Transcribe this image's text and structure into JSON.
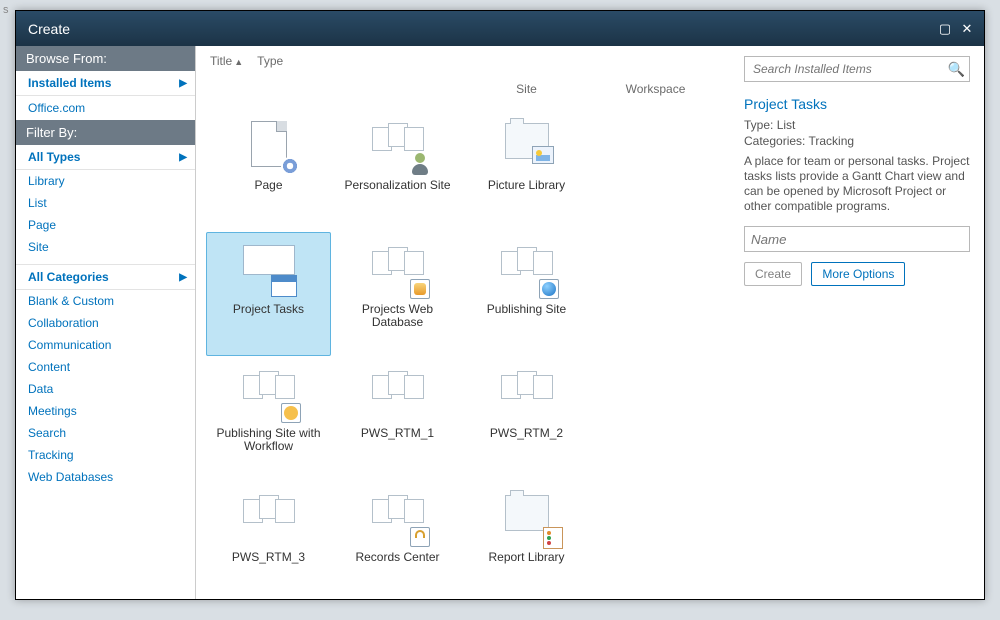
{
  "dialog_title": "Create",
  "sidebar": {
    "browse_header": "Browse From:",
    "browse_items": [
      "Installed Items",
      "Office.com"
    ],
    "filter_header": "Filter By:",
    "all_types": "All Types",
    "types": [
      "Library",
      "List",
      "Page",
      "Site"
    ],
    "all_categories": "All Categories",
    "categories": [
      "Blank & Custom",
      "Collaboration",
      "Communication",
      "Content",
      "Data",
      "Meetings",
      "Search",
      "Tracking",
      "Web Databases"
    ]
  },
  "list": {
    "sort_title": "Title",
    "sort_type": "Type",
    "type_headers": [
      "",
      "",
      "Site",
      "Workspace"
    ],
    "items": [
      {
        "label": "Page"
      },
      {
        "label": "Personalization Site"
      },
      {
        "label": "Picture Library"
      },
      {
        "label": "Project Tasks",
        "selected": true
      },
      {
        "label": "Projects Web Database"
      },
      {
        "label": "Publishing Site"
      },
      {
        "label": "Publishing Site with Workflow"
      },
      {
        "label": "PWS_RTM_1"
      },
      {
        "label": "PWS_RTM_2"
      },
      {
        "label": "PWS_RTM_3"
      },
      {
        "label": "Records Center"
      },
      {
        "label": "Report Library"
      }
    ]
  },
  "search_placeholder": "Search Installed Items",
  "detail": {
    "title": "Project Tasks",
    "type_label": "Type:",
    "type_value": "List",
    "cat_label": "Categories:",
    "cat_value": "Tracking",
    "description": "A place for team or personal tasks. Project tasks lists provide a Gantt Chart view and can be opened by Microsoft Project or other compatible programs.",
    "name_placeholder": "Name",
    "create_btn": "Create",
    "more_btn": "More Options"
  }
}
